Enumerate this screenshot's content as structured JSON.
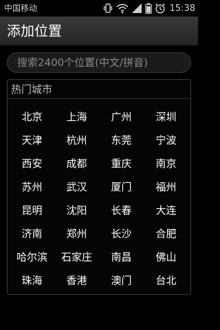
{
  "status_bar": {
    "carrier": "中国移动",
    "time": "15:38",
    "icons": [
      "vibrate-icon",
      "wifi-icon",
      "signal-icon",
      "battery-icon",
      "alarm-icon"
    ]
  },
  "header": {
    "title": "添加位置"
  },
  "search": {
    "placeholder": "搜索2400个位置(中文/拼音)"
  },
  "hot_cities": {
    "title": "热门城市",
    "cities": [
      "北京",
      "上海",
      "广州",
      "深圳",
      "天津",
      "杭州",
      "东莞",
      "宁波",
      "西安",
      "成都",
      "重庆",
      "南京",
      "苏州",
      "武汉",
      "厦门",
      "福州",
      "昆明",
      "沈阳",
      "长春",
      "大连",
      "济南",
      "郑州",
      "长沙",
      "合肥",
      "哈尔滨",
      "石家庄",
      "南昌",
      "佛山",
      "珠海",
      "香港",
      "澳门",
      "台北"
    ]
  }
}
